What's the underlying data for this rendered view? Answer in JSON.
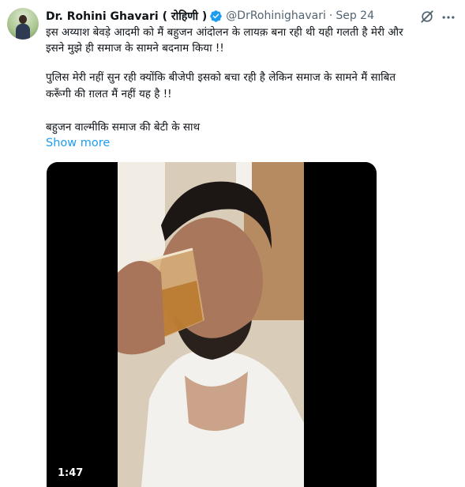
{
  "author": {
    "display_name": "Dr. Rohini Ghavari ( रोहिणी )",
    "handle": "@DrRohinighavari",
    "separator": "·",
    "date": "Sep 24"
  },
  "tweet": {
    "lines": [
      "इस अय्याश बेवड़े आदमी को मैं बहुजन आंदोलन के लायक़ बना रही थी यही गलती है मेरी और",
      "इसने मुझे ही समाज के सामने बदनाम किया !!",
      "पुलिस मेरी नहीं सुन रही क्योंकि बीजेपी इसको बचा रही है लेकिन समाज के सामने मैं साबित",
      "करूँगी की ग़लत मैं नहीं यह है !!",
      "बहुजन वाल्मीकि समाज की बेटी के साथ"
    ],
    "show_more": "Show more"
  },
  "media": {
    "duration": "1:47"
  },
  "icons": {
    "verified": "verified-badge-icon",
    "grok": "grok-icon",
    "more": "more-horizontal-icon"
  },
  "colors": {
    "link": "#1d9bf0",
    "verified": "#1d9bf0",
    "secondary_text": "#536471",
    "primary_text": "#0f1419"
  }
}
